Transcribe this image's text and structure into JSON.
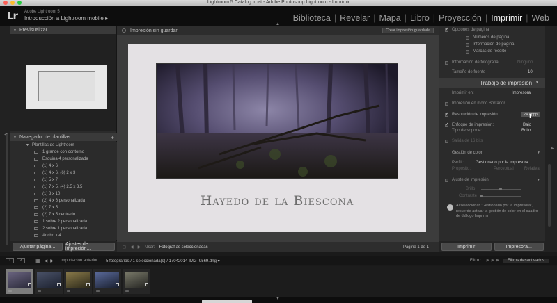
{
  "window": {
    "title": "Lightroom 5 Catalog.lrcat - Adobe Photoshop Lightroom - Imprimir"
  },
  "identity": {
    "logo": "Lr",
    "app_name": "Adobe Lightroom 5",
    "app_subtitle": "Introducción a Lightroom mobile ▸"
  },
  "modules": {
    "items": [
      {
        "label": "Biblioteca"
      },
      {
        "label": "Revelar"
      },
      {
        "label": "Mapa"
      },
      {
        "label": "Libro"
      },
      {
        "label": "Proyección"
      },
      {
        "label": "Imprimir",
        "active": true
      },
      {
        "label": "Web"
      }
    ]
  },
  "left_panel": {
    "preview_title": "Previsualizar",
    "template_browser_title": "Navegador de plantillas",
    "folder_label": "Plantillas de Lightroom",
    "templates": [
      "1 grande con contorno",
      "Esquina 4 personalizada",
      "(1) 4 x 6",
      "(1) 4 x 6, (6) 2 x 3",
      "(1) 5 x 7",
      "(1) 7 x 5, (4) 2.5 x 3.5",
      "(1) 8 x 10",
      "(2) 4 x 6 personalizada",
      "(2) 7 x 5",
      "(2) 7 x 5 centrado",
      "1 sobre 2 personalizada",
      "2 sobre 1 personalizada",
      "Ancho x 4"
    ],
    "page_setup_button": "Ajustar página...",
    "print_settings_button": "Ajustes de impresión..."
  },
  "center": {
    "header_title": "Impresión sin guardar",
    "create_saved_button": "Crear impresión guardada",
    "photo_caption": "Hayedo de la Biescona",
    "toolbar": {
      "use_label": "Usar:",
      "use_value": "Fotografías seleccionadas",
      "page_indicator": "Página 1 de 1"
    }
  },
  "right_panel": {
    "page_options_title": "Opciones de página",
    "page_numbers": "Números de página",
    "page_info": "Información de página",
    "crop_marks": "Marcas de recorte",
    "photo_info_label": "Información de fotografía",
    "photo_info_value": "Ninguno",
    "font_size_label": "Tamaño de fuente :",
    "font_size_value": "10",
    "print_job_title": "Trabajo de impresión",
    "print_to_label": "Imprimir en:",
    "print_to_value": "Impresora",
    "draft_mode": "Impresión en modo Borrador",
    "resolution_label": "Resolución de impresión",
    "resolution_value": "240 ppp",
    "sharpen_label": "Enfoque de impresión:",
    "sharpen_value": "Bajo",
    "media_type_label": "Tipo de soporte:",
    "media_type_value": "Brillo",
    "sixteen_bit": "Salida de 16 bits",
    "color_mgmt_title": "Gestión de color",
    "profile_label": "Perfil :",
    "profile_value": "Gestionado por la impresora",
    "intent_label": "Propósito:",
    "intent_perceptual": "Perceptual",
    "intent_relative": "Relativa",
    "print_adjust_label": "Ajuste de impresión",
    "brightness_label": "Brillo",
    "contrast_label": "Contraste",
    "info_note": "Al seleccionar \"Gestionado por la impresora\", recuerde activar la gestión de color en el cuadro de diálogo Imprimir.",
    "print_button": "Imprimir",
    "printer_button": "Impresora..."
  },
  "filmstrip": {
    "view_1": "1",
    "view_2": "2",
    "previous_import": "Importación anterior",
    "selection_info": "5 fotografías / 1 seleccionada(s) / 17042014-IMG_9569.dng ▾",
    "filter_label": "Filtro :",
    "filter_value": "Filtros desactivados",
    "thumbnails": [
      {
        "selected": true,
        "colors": [
          "#6a6480",
          "#2b2a3a"
        ]
      },
      {
        "selected": false,
        "colors": [
          "#4a5268",
          "#1d2230"
        ]
      },
      {
        "selected": false,
        "colors": [
          "#8a7a4a",
          "#2d2a1a"
        ]
      },
      {
        "selected": false,
        "colors": [
          "#5a6a9a",
          "#1a2030"
        ]
      },
      {
        "selected": false,
        "colors": [
          "#7a7a6a",
          "#252522"
        ]
      }
    ]
  },
  "colors": {
    "active_module": "#f0f0f0",
    "panel_bg": "#2b2b2b",
    "paper": "#e4e1e4"
  }
}
